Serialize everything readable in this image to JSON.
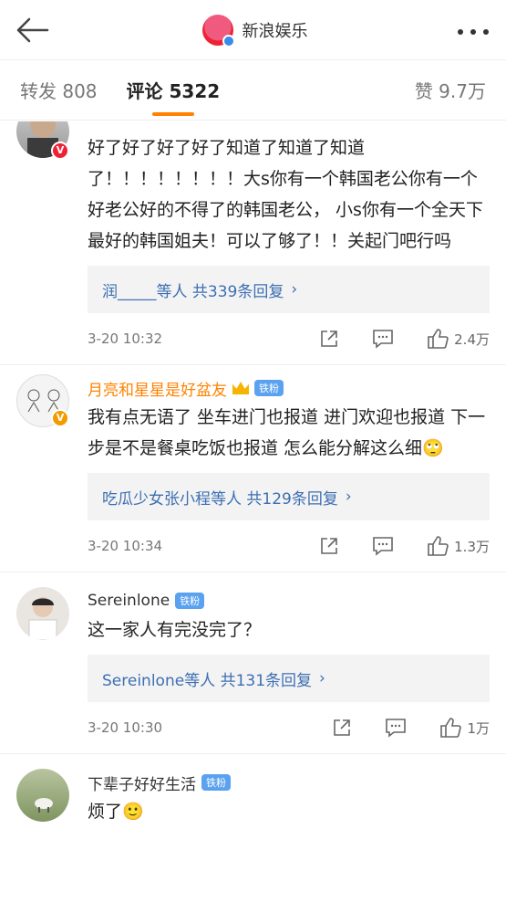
{
  "header": {
    "back_icon": "back-arrow-icon",
    "title": "新浪娱乐",
    "more_icon": "more-dots-icon"
  },
  "tabs": [
    {
      "label": "转发 808"
    },
    {
      "label": "评论 5322"
    },
    {
      "label": "赞 9.7万"
    }
  ],
  "comments": [
    {
      "name": "",
      "badge_color": "#e23",
      "text": "好了好了好了好了知道了知道了知道了！！！！！！！！大s你有一个韩国老公你有一个好老公好的不得了的韩国老公， 小s你有一个全天下最好的韩国姐夫！可以了够了！！关起门吧行吗",
      "replies": "润_____等人 共339条回复",
      "time": "3-20 10:32",
      "likes": "2.4万"
    },
    {
      "name": "月亮和星星是好盆友",
      "tag": "铁粉",
      "text": "我有点无语了 坐车进门也报道 进门欢迎也报道 下一步是不是餐桌吃饭也报道 怎么能分解这么细🙄",
      "replies": "吃瓜少女张小程等人 共129条回复",
      "time": "3-20 10:34",
      "likes": "1.3万"
    },
    {
      "name": "Sereinlone",
      "tag": "铁粉",
      "text": "这一家人有完没完了？",
      "replies": "Sereinlone等人 共131条回复",
      "time": "3-20 10:30",
      "likes": "1万"
    },
    {
      "name": "下辈子好好生活",
      "tag": "铁粉",
      "text": "烦了🙂"
    }
  ],
  "chevron": "›"
}
